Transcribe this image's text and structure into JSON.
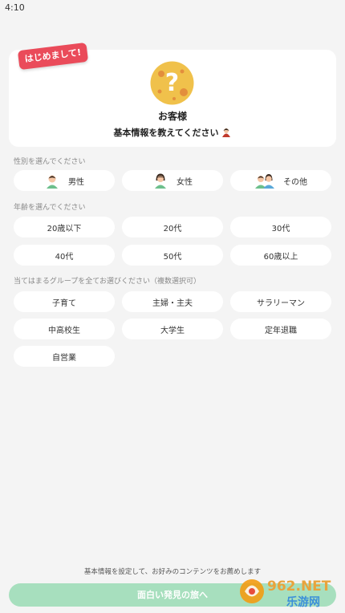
{
  "status_bar": {
    "time": "4:10"
  },
  "card": {
    "ribbon": "はじめまして!",
    "user_name": "お客様",
    "subtitle": "基本情報を教えてください"
  },
  "gender_section": {
    "label": "性別を選んでください",
    "options": [
      "男性",
      "女性",
      "その他"
    ]
  },
  "age_section": {
    "label": "年齢を選んでください",
    "options": [
      "20歳以下",
      "20代",
      "30代",
      "40代",
      "50代",
      "60歳以上"
    ]
  },
  "group_section": {
    "label": "当てはまるグループを全てお選びください（複数選択可）",
    "options": [
      "子育て",
      "主婦・主夫",
      "サラリーマン",
      "中高校生",
      "大学生",
      "定年退職",
      "自営業"
    ]
  },
  "footer": {
    "note": "基本情報を設定して、お好みのコンテンツをお薦めします",
    "button_label": "面白い発見の旅へ"
  },
  "watermark": {
    "brand": "962.NET",
    "sub": "乐游网"
  },
  "colors": {
    "background": "#f4f4f4",
    "ribbon": "#ea4b5a",
    "button": "#a7dfbe",
    "avatar": "#f0c14b",
    "icon_green": "#6dbf8c"
  }
}
